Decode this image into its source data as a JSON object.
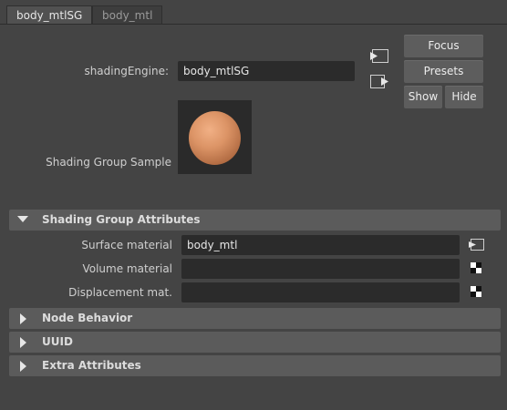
{
  "tabs": [
    {
      "label": "body_mtlSG"
    },
    {
      "label": "body_mtl"
    }
  ],
  "shading_engine": {
    "label": "shadingEngine:",
    "value": "body_mtlSG"
  },
  "buttons": {
    "focus": "Focus",
    "presets": "Presets",
    "show": "Show",
    "hide": "Hide"
  },
  "sample": {
    "label": "Shading Group Sample"
  },
  "sections": {
    "shading_group_attributes": "Shading Group Attributes",
    "node_behavior": "Node Behavior",
    "uuid": "UUID",
    "extra_attributes": "Extra Attributes"
  },
  "attributes": {
    "surface_label": "Surface material",
    "surface_value": "body_mtl",
    "volume_label": "Volume material",
    "volume_value": "",
    "displacement_label": "Displacement mat.",
    "displacement_value": ""
  },
  "colors": {
    "background": "#444444",
    "field": "#2b2b2b",
    "section_header": "#5b5b5b",
    "button": "#5d5d5d",
    "sphere": "#d08b5e"
  }
}
